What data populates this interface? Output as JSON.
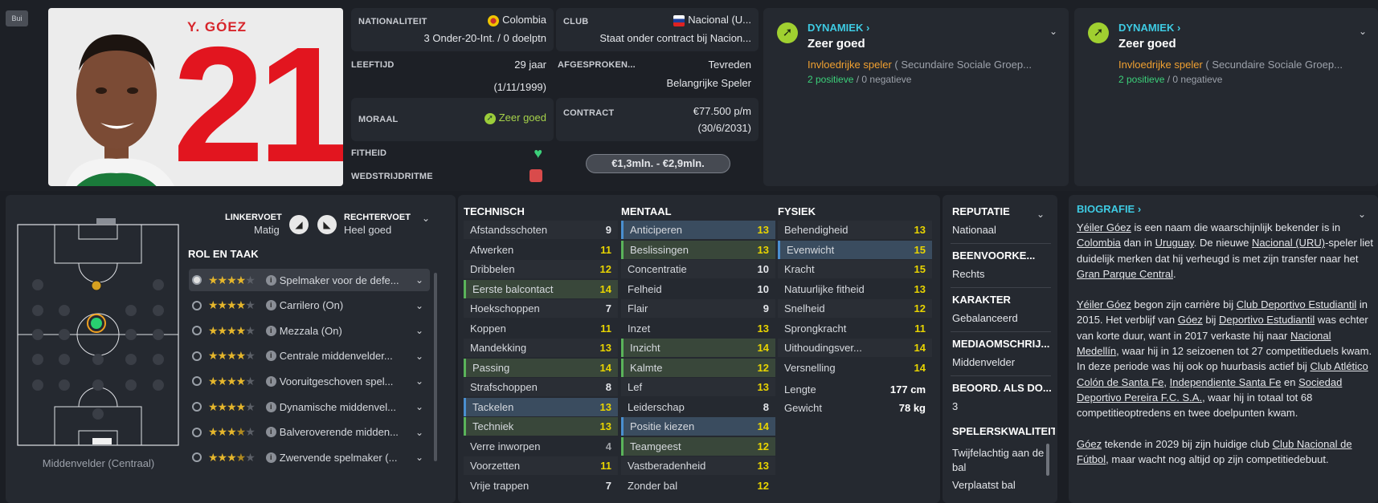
{
  "kit_button": "Bui",
  "player": {
    "name": "Y. GÓEZ",
    "number": "21"
  },
  "info": {
    "nationality_label": "NATIONALITEIT",
    "nationality": "Colombia",
    "caps": "3 Onder-20-Int. / 0 doelptn",
    "club_label": "CLUB",
    "club": "Nacional (U...",
    "contract_status": "Staat onder contract bij Nacion...",
    "age_label": "LEEFTIJD",
    "age": "29 jaar",
    "dob": "(1/11/1999)",
    "agreed_label": "AFGESPROKEN...",
    "agreed_value": "Tevreden",
    "agreed_role": "Belangrijke Speler",
    "morale_label": "MORAAL",
    "morale": "Zeer goed",
    "contract_label": "CONTRACT",
    "wage": "€77.500 p/m",
    "contract_end": "(30/6/2031)",
    "fitness_label": "FITHEID",
    "match_label": "WEDSTRIJDRITME",
    "value_range": "€1,3mln. - €2,9mln."
  },
  "dynamics": [
    {
      "title": "DYNAMIEK",
      "status": "Zeer goed",
      "influence": "Invloedrijke speler",
      "group": "( Secundaire Sociale Groep...",
      "positive": "2 positieve",
      "separator": "/",
      "negative": "0 negatieve"
    },
    {
      "title": "DYNAMIEK",
      "status": "Zeer goed",
      "influence": "Invloedrijke speler",
      "group": "( Secundaire Sociale Groep...",
      "positive": "2 positieve",
      "separator": "/",
      "negative": "0 negatieve"
    }
  ],
  "feet": {
    "left_label": "LINKERVOET",
    "left": "Matig",
    "right_label": "RECHTERVOET",
    "right": "Heel goed"
  },
  "position_caption": "Middenvelder (Centraal)",
  "roles_title": "ROL EN TAAK",
  "roles": [
    {
      "name": "Spelmaker voor de defe...",
      "stars": 4,
      "half": false
    },
    {
      "name": "Carrilero (On)",
      "stars": 4,
      "half": false
    },
    {
      "name": "Mezzala (On)",
      "stars": 4,
      "half": false
    },
    {
      "name": "Centrale middenvelder...",
      "stars": 4,
      "half": false
    },
    {
      "name": "Vooruitgeschoven spel...",
      "stars": 4,
      "half": false
    },
    {
      "name": "Dynamische middenvel...",
      "stars": 4,
      "half": false
    },
    {
      "name": "Balveroverende midden...",
      "stars": 3,
      "half": true
    },
    {
      "name": "Zwervende spelmaker (...",
      "stars": 3,
      "half": true
    }
  ],
  "technical_title": "TECHNISCH",
  "technical": [
    {
      "k": "Afstandsschoten",
      "v": "9",
      "c": "w",
      "h": ""
    },
    {
      "k": "Afwerken",
      "v": "11",
      "c": "y",
      "h": ""
    },
    {
      "k": "Dribbelen",
      "v": "12",
      "c": "y",
      "h": ""
    },
    {
      "k": "Eerste balcontact",
      "v": "14",
      "c": "y",
      "h": "g"
    },
    {
      "k": "Hoekschoppen",
      "v": "7",
      "c": "w",
      "h": ""
    },
    {
      "k": "Koppen",
      "v": "11",
      "c": "y",
      "h": ""
    },
    {
      "k": "Mandekking",
      "v": "13",
      "c": "y",
      "h": ""
    },
    {
      "k": "Passing",
      "v": "14",
      "c": "y",
      "h": "g"
    },
    {
      "k": "Strafschoppen",
      "v": "8",
      "c": "w",
      "h": ""
    },
    {
      "k": "Tackelen",
      "v": "13",
      "c": "y",
      "h": "b"
    },
    {
      "k": "Techniek",
      "v": "13",
      "c": "y",
      "h": "g"
    },
    {
      "k": "Verre inworpen",
      "v": "4",
      "c": "g",
      "h": ""
    },
    {
      "k": "Voorzetten",
      "v": "11",
      "c": "y",
      "h": ""
    },
    {
      "k": "Vrije trappen",
      "v": "7",
      "c": "w",
      "h": ""
    }
  ],
  "mental_title": "MENTAAL",
  "mental": [
    {
      "k": "Anticiperen",
      "v": "13",
      "c": "y",
      "h": "b"
    },
    {
      "k": "Beslissingen",
      "v": "13",
      "c": "y",
      "h": "g"
    },
    {
      "k": "Concentratie",
      "v": "10",
      "c": "w",
      "h": ""
    },
    {
      "k": "Felheid",
      "v": "10",
      "c": "w",
      "h": ""
    },
    {
      "k": "Flair",
      "v": "9",
      "c": "w",
      "h": ""
    },
    {
      "k": "Inzet",
      "v": "13",
      "c": "y",
      "h": ""
    },
    {
      "k": "Inzicht",
      "v": "14",
      "c": "y",
      "h": "g"
    },
    {
      "k": "Kalmte",
      "v": "12",
      "c": "y",
      "h": "g"
    },
    {
      "k": "Lef",
      "v": "13",
      "c": "y",
      "h": ""
    },
    {
      "k": "Leiderschap",
      "v": "8",
      "c": "w",
      "h": ""
    },
    {
      "k": "Positie kiezen",
      "v": "14",
      "c": "y",
      "h": "b"
    },
    {
      "k": "Teamgeest",
      "v": "12",
      "c": "y",
      "h": "g"
    },
    {
      "k": "Vastberadenheid",
      "v": "13",
      "c": "y",
      "h": ""
    },
    {
      "k": "Zonder bal",
      "v": "12",
      "c": "y",
      "h": ""
    }
  ],
  "physical_title": "FYSIEK",
  "physical": [
    {
      "k": "Behendigheid",
      "v": "13",
      "c": "y",
      "h": ""
    },
    {
      "k": "Evenwicht",
      "v": "15",
      "c": "y",
      "h": "b"
    },
    {
      "k": "Kracht",
      "v": "15",
      "c": "y",
      "h": ""
    },
    {
      "k": "Natuurlijke fitheid",
      "v": "13",
      "c": "y",
      "h": ""
    },
    {
      "k": "Snelheid",
      "v": "12",
      "c": "y",
      "h": ""
    },
    {
      "k": "Sprongkracht",
      "v": "11",
      "c": "y",
      "h": ""
    },
    {
      "k": "Uithoudingsver...",
      "v": "14",
      "c": "y",
      "h": ""
    },
    {
      "k": "Versnelling",
      "v": "14",
      "c": "y",
      "h": ""
    }
  ],
  "body": {
    "length_label": "Lengte",
    "length": "177 cm",
    "weight_label": "Gewicht",
    "weight": "78 kg"
  },
  "reputation": [
    {
      "k": "REPUTATIE",
      "v": "Nationaal"
    },
    {
      "k": "BEENVOORKE...",
      "v": "Rechts"
    },
    {
      "k": "KARAKTER",
      "v": "Gebalanceerd"
    },
    {
      "k": "MEDIAOMSCHRIJ...",
      "v": "Middenvelder"
    },
    {
      "k": "BEOORD. ALS DO...",
      "v": "3"
    }
  ],
  "qualities_title": "SPELERSKWALITEIT",
  "qualities": [
    "Twijfelachtig aan de bal",
    "Verplaatst bal"
  ],
  "bio_title": "BIOGRAFIE"
}
